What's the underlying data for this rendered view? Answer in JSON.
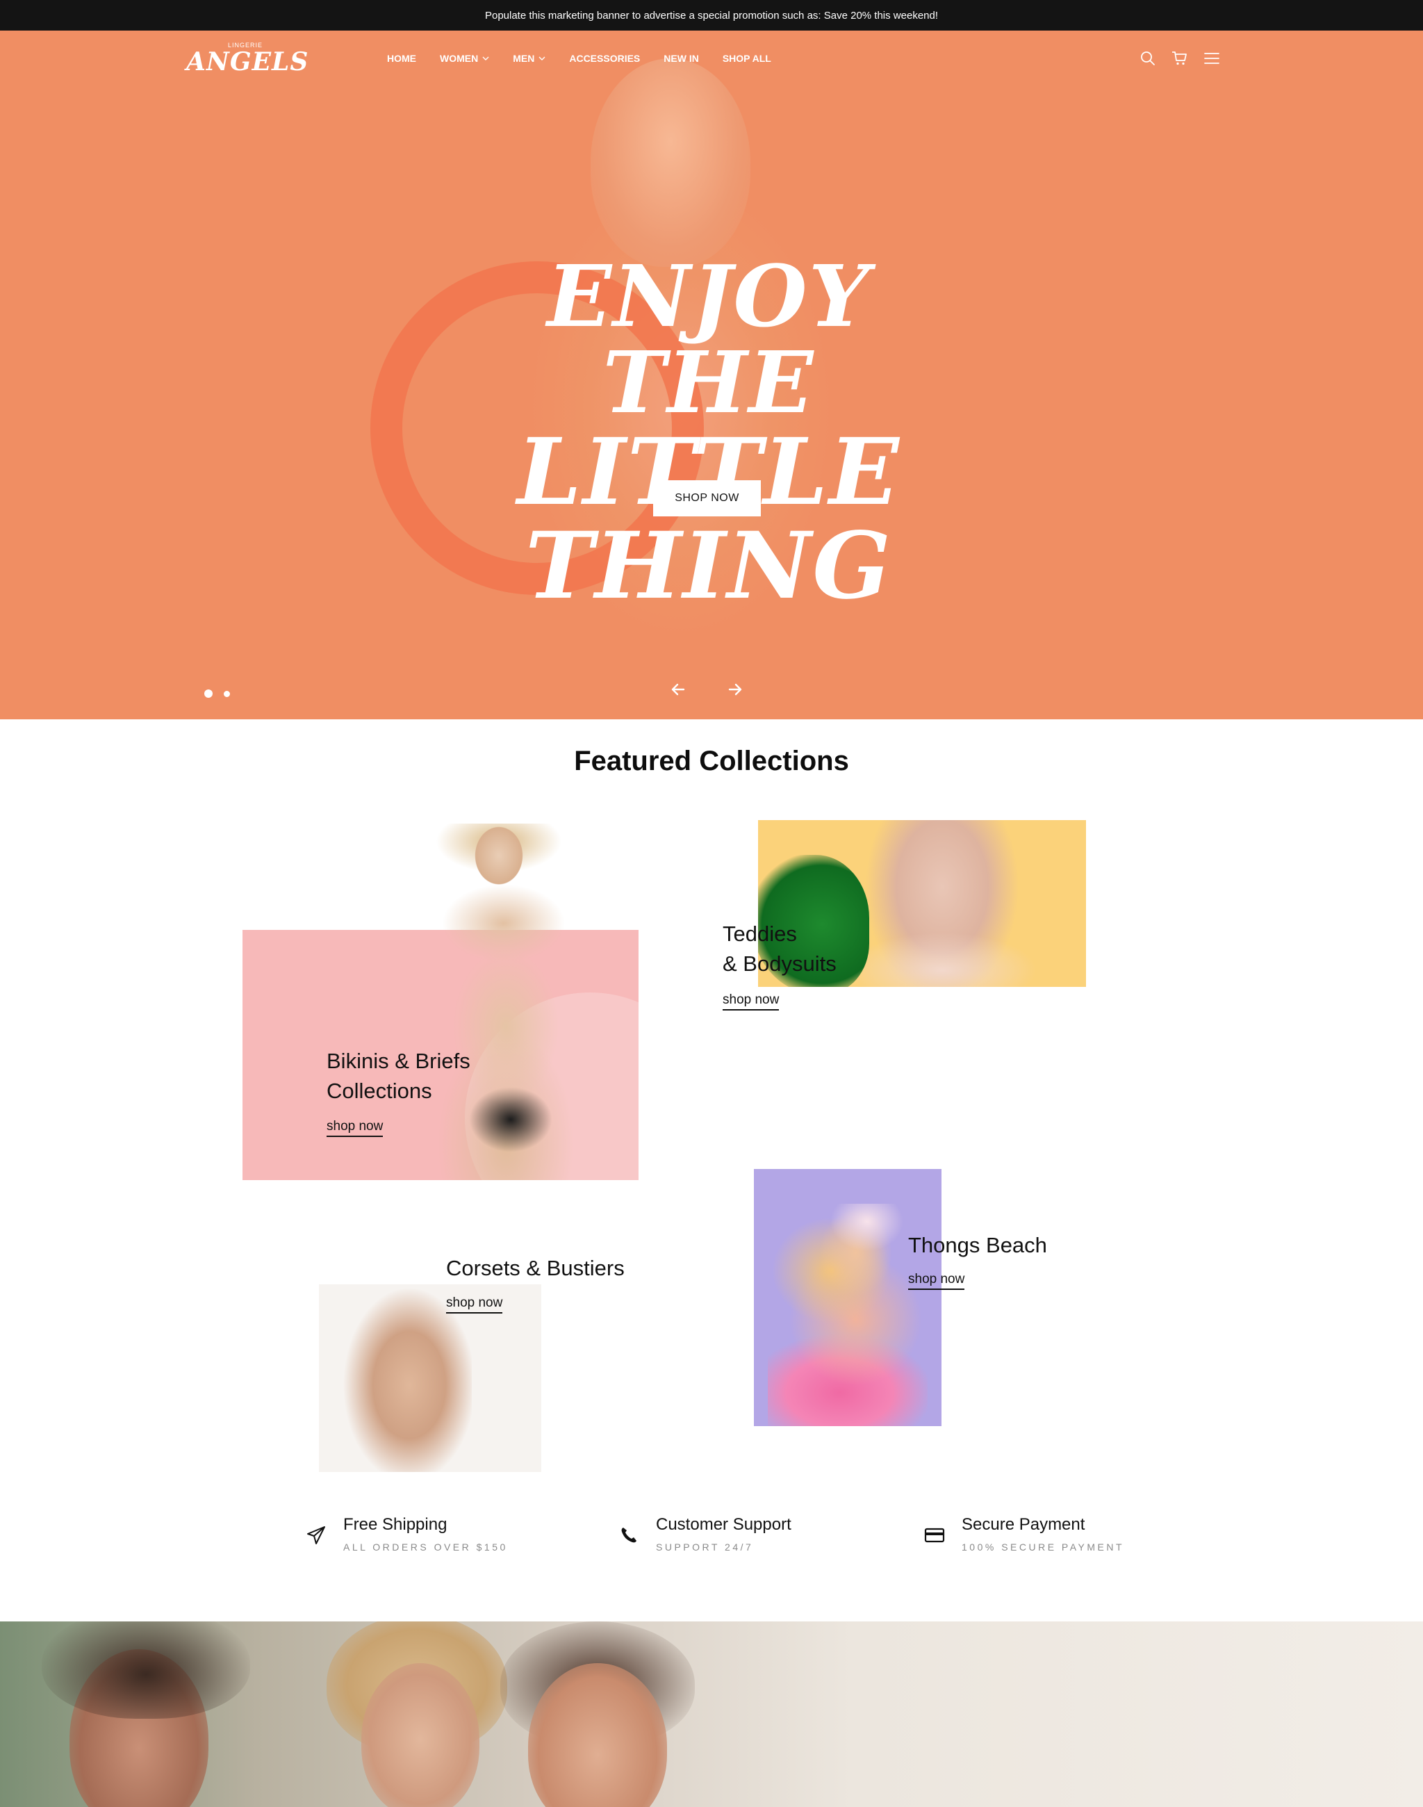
{
  "announcement": {
    "text": "Populate this marketing banner to advertise a special promotion such as: Save 20% this weekend!"
  },
  "header": {
    "logo_small": "LINGERIE",
    "logo_main": "ANGELS",
    "nav": [
      {
        "label": "HOME",
        "has_dropdown": false
      },
      {
        "label": "WOMEN",
        "has_dropdown": true
      },
      {
        "label": "MEN",
        "has_dropdown": true
      },
      {
        "label": "ACCESSORIES",
        "has_dropdown": false
      },
      {
        "label": "NEW IN",
        "has_dropdown": false
      },
      {
        "label": "SHOP ALL",
        "has_dropdown": false
      }
    ],
    "icons": [
      "search-icon",
      "cart-icon",
      "menu-icon"
    ]
  },
  "hero": {
    "title_line1": "Enjoy The",
    "title_line2": "Little Thing",
    "cta_label": "SHOP NOW",
    "slide_count": 2,
    "active_slide": 1,
    "background_color": "#f08e63"
  },
  "featured": {
    "title": "Featured Collections",
    "collections": [
      {
        "label_line1": "Bikinis & Briefs",
        "label_line2": "Collections",
        "link": "shop now",
        "color": "#f7b9b9"
      },
      {
        "label_line1": "Teddies",
        "label_line2": "& Bodysuits",
        "link": "shop now",
        "color": "#fbd27a"
      },
      {
        "label_line1": "Corsets & Bustiers",
        "link": "shop now",
        "color": "#f6f3f0"
      },
      {
        "label_line1": "Thongs Beach",
        "link": "shop now",
        "color": "#b3a6e6"
      }
    ]
  },
  "features": [
    {
      "icon": "paper-plane-icon",
      "title": "Free Shipping",
      "subtitle": "ALL ORDERS OVER $150"
    },
    {
      "icon": "phone-icon",
      "title": "Customer Support",
      "subtitle": "SUPPORT 24/7"
    },
    {
      "icon": "credit-card-icon",
      "title": "Secure Payment",
      "subtitle": "100% SECURE PAYMENT"
    }
  ]
}
